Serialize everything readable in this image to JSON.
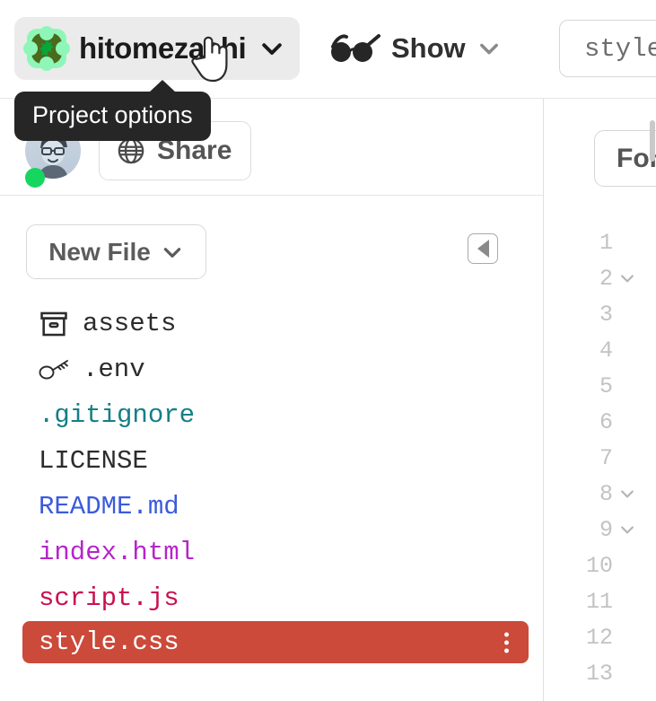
{
  "topbar": {
    "project": {
      "name": "hitomezashi",
      "icon": "project-logo-icon",
      "chevron": "chevron-down-icon"
    },
    "show": {
      "icon": "glasses-icon",
      "label": "Show",
      "chevron": "chevron-down-icon"
    },
    "editor_tab": {
      "label": "style"
    }
  },
  "tooltip": {
    "text": "Project options"
  },
  "panel_header": {
    "avatar": "user-avatar",
    "status": "online",
    "share": {
      "icon": "globe-icon",
      "label": "Share"
    },
    "collapse": {
      "icon": "collapse-left-icon"
    }
  },
  "sidebar": {
    "new_file": {
      "label": "New File",
      "chevron": "chevron-down-icon"
    },
    "files": [
      {
        "name": "assets",
        "ext": "",
        "icon": "archive-box-icon",
        "color": "default",
        "selected": false
      },
      {
        "name": ".env",
        "ext": "",
        "icon": "key-icon",
        "color": "default",
        "selected": false
      },
      {
        "name": ".gitignore",
        "ext": "",
        "icon": "",
        "color": "teal",
        "selected": false
      },
      {
        "name": "LICENSE",
        "ext": "",
        "icon": "",
        "color": "default",
        "selected": false
      },
      {
        "name": "README",
        "ext": ".md",
        "icon": "",
        "color": "md",
        "selected": false
      },
      {
        "name": "index",
        "ext": ".html",
        "icon": "",
        "color": "html",
        "selected": false
      },
      {
        "name": "script",
        "ext": ".js",
        "icon": "",
        "color": "js",
        "selected": false
      },
      {
        "name": "style.css",
        "ext": "",
        "icon": "",
        "color": "default",
        "selected": true,
        "menu": "kebab-menu-icon"
      }
    ]
  },
  "editor": {
    "format_button": {
      "label": "For"
    },
    "lines": [
      {
        "num": "1",
        "fold": false
      },
      {
        "num": "2",
        "fold": true
      },
      {
        "num": "3",
        "fold": false
      },
      {
        "num": "4",
        "fold": false
      },
      {
        "num": "5",
        "fold": false
      },
      {
        "num": "6",
        "fold": false
      },
      {
        "num": "7",
        "fold": false
      },
      {
        "num": "8",
        "fold": true
      },
      {
        "num": "9",
        "fold": true
      },
      {
        "num": "10",
        "fold": false
      },
      {
        "num": "11",
        "fold": false
      },
      {
        "num": "12",
        "fold": false
      },
      {
        "num": "13",
        "fold": false
      }
    ]
  },
  "colors": {
    "selected_row": "#cb4a3a",
    "status_online": "#16d660",
    "tooltip_bg": "#262626",
    "ext_md": "#3b5bdb",
    "ext_html": "#b525c9",
    "ext_js": "#c9114f",
    "gitignore": "#157f86",
    "logo_bg": "#8ef7b8",
    "logo_fg": "#4a6b1e"
  }
}
